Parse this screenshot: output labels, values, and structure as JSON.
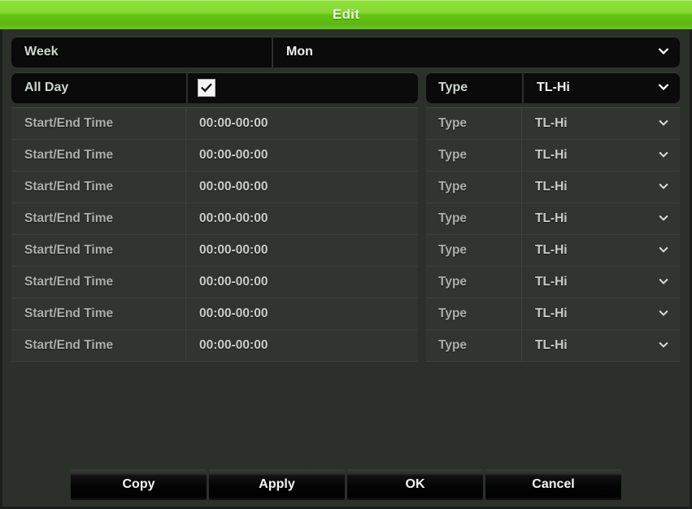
{
  "window": {
    "title": "Edit",
    "title_bar_color": "#63c312"
  },
  "week": {
    "label": "Week",
    "value": "Mon",
    "chevron_icon": "chevron-down-icon"
  },
  "all_day": {
    "label": "All Day",
    "checked": true,
    "checkbox_icon": "checkmark-icon",
    "type_label": "Type",
    "type_value": "TL-Hi",
    "chevron_icon": "chevron-down-icon"
  },
  "schedule": {
    "time_label": "Start/End Time",
    "type_label": "Type",
    "rows": [
      {
        "time_label": "Start/End Time",
        "time": "00:00-00:00",
        "type_label": "Type",
        "type": "TL-Hi"
      },
      {
        "time_label": "Start/End Time",
        "time": "00:00-00:00",
        "type_label": "Type",
        "type": "TL-Hi"
      },
      {
        "time_label": "Start/End Time",
        "time": "00:00-00:00",
        "type_label": "Type",
        "type": "TL-Hi"
      },
      {
        "time_label": "Start/End Time",
        "time": "00:00-00:00",
        "type_label": "Type",
        "type": "TL-Hi"
      },
      {
        "time_label": "Start/End Time",
        "time": "00:00-00:00",
        "type_label": "Type",
        "type": "TL-Hi"
      },
      {
        "time_label": "Start/End Time",
        "time": "00:00-00:00",
        "type_label": "Type",
        "type": "TL-Hi"
      },
      {
        "time_label": "Start/End Time",
        "time": "00:00-00:00",
        "type_label": "Type",
        "type": "TL-Hi"
      },
      {
        "time_label": "Start/End Time",
        "time": "00:00-00:00",
        "type_label": "Type",
        "type": "TL-Hi"
      }
    ]
  },
  "buttons": {
    "copy": "Copy",
    "apply": "Apply",
    "ok": "OK",
    "cancel": "Cancel"
  }
}
